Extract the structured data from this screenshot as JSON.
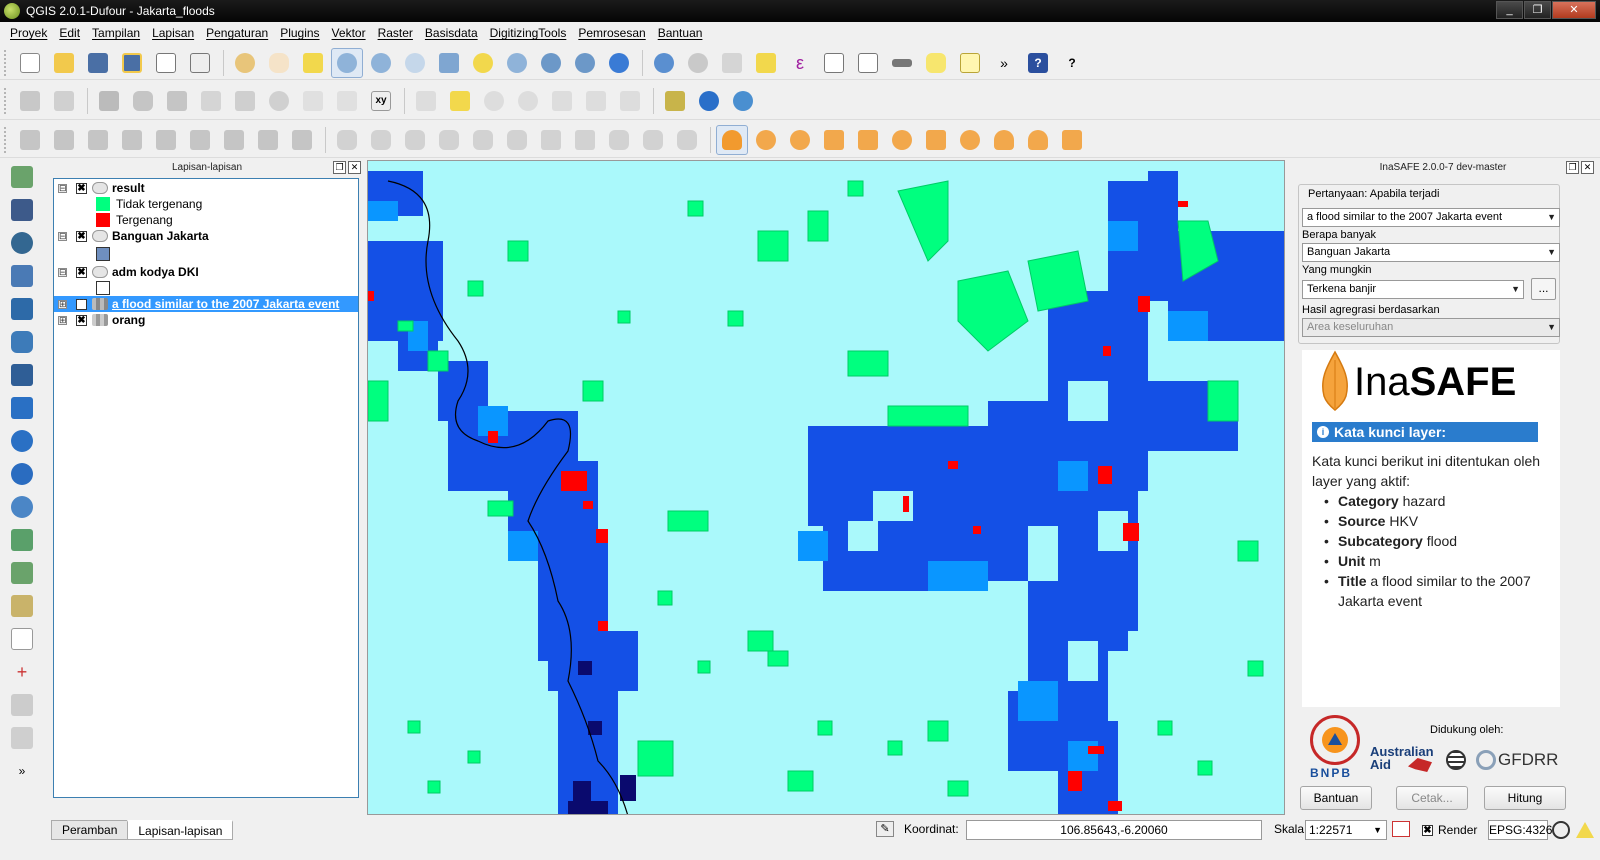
{
  "window": {
    "title": "QGIS 2.0.1-Dufour - Jakarta_floods",
    "controls": [
      "_",
      "❐",
      "✕"
    ]
  },
  "menu": [
    "Proyek",
    "Edit",
    "Tampilan",
    "Lapisan",
    "Pengaturan",
    "Plugins",
    "Vektor",
    "Raster",
    "Basisdata",
    "DigitizingTools",
    "Pemrosesan",
    "Bantuan"
  ],
  "toolbar_overflow": "»",
  "layers_panel": {
    "title": "Lapisan-lapisan",
    "layers": [
      {
        "name": "result",
        "checked": "✖",
        "expander": "⊟"
      },
      {
        "legend": "Tidak tergenang",
        "color": "#00ff7f"
      },
      {
        "legend": "Tergenang",
        "color": "#ff0000"
      },
      {
        "name": "Banguan Jakarta",
        "checked": "✖",
        "expander": "⊟"
      },
      {
        "name": "adm kodya DKI",
        "checked": "✖",
        "expander": "⊟"
      },
      {
        "name": "a flood similar to the 2007 Jakarta event",
        "checked": "✖",
        "expander": "⊞"
      },
      {
        "name": "orang",
        "checked": "✖",
        "expander": "⊞"
      }
    ],
    "tabs": [
      "Peramban",
      "Lapisan-lapisan"
    ]
  },
  "inasafe": {
    "title": "InaSAFE 2.0.0-7 dev-master",
    "question_label": "Pertanyaan: Apabila terjadi",
    "hazard_value": "a flood similar to the 2007 Jakarta event",
    "how_many_label": "Berapa banyak",
    "exposure_value": "Banguan Jakarta",
    "might_label": "Yang mungkin",
    "function_value": "Terkena banjir",
    "more_button": "...",
    "aggregation_label": "Hasil agregrasi berdasarkan",
    "aggregation_value": "Area keseluruhan",
    "logo_ina": "Ina",
    "logo_safe": "SAFE",
    "keywords_heading": "Kata kunci layer:",
    "keywords_intro": "Kata kunci berikut ini ditentukan oleh layer yang aktif:",
    "keywords": [
      {
        "key": "Category",
        "value": "hazard"
      },
      {
        "key": "Source",
        "value": "HKV"
      },
      {
        "key": "Subcategory",
        "value": "flood"
      },
      {
        "key": "Unit",
        "value": "m"
      },
      {
        "key": "Title",
        "value": "a flood similar to the 2007 Jakarta event"
      }
    ],
    "supported_by": "Didukung oleh:",
    "sponsors": {
      "bnpb": "BNPB",
      "australian": "Australian",
      "aid": "Aid",
      "gfdrr": "GFDRR"
    },
    "buttons": {
      "help": "Bantuan",
      "print": "Cetak...",
      "run": "Hitung"
    }
  },
  "statusbar": {
    "coord_label": "Koordinat:",
    "coord_value": "106.85643,-6.20060",
    "scale_label": "Skala",
    "scale_value": "1:22571",
    "render_label": "Render",
    "epsg": "EPSG:4326"
  },
  "colors": {
    "not_flooded": "#00ff7f",
    "flooded": "#ff0000",
    "water_deep": "#1450e6",
    "water_mid": "#0a96ff",
    "background": "#aaf9fb",
    "highlight": "#3399ff"
  }
}
